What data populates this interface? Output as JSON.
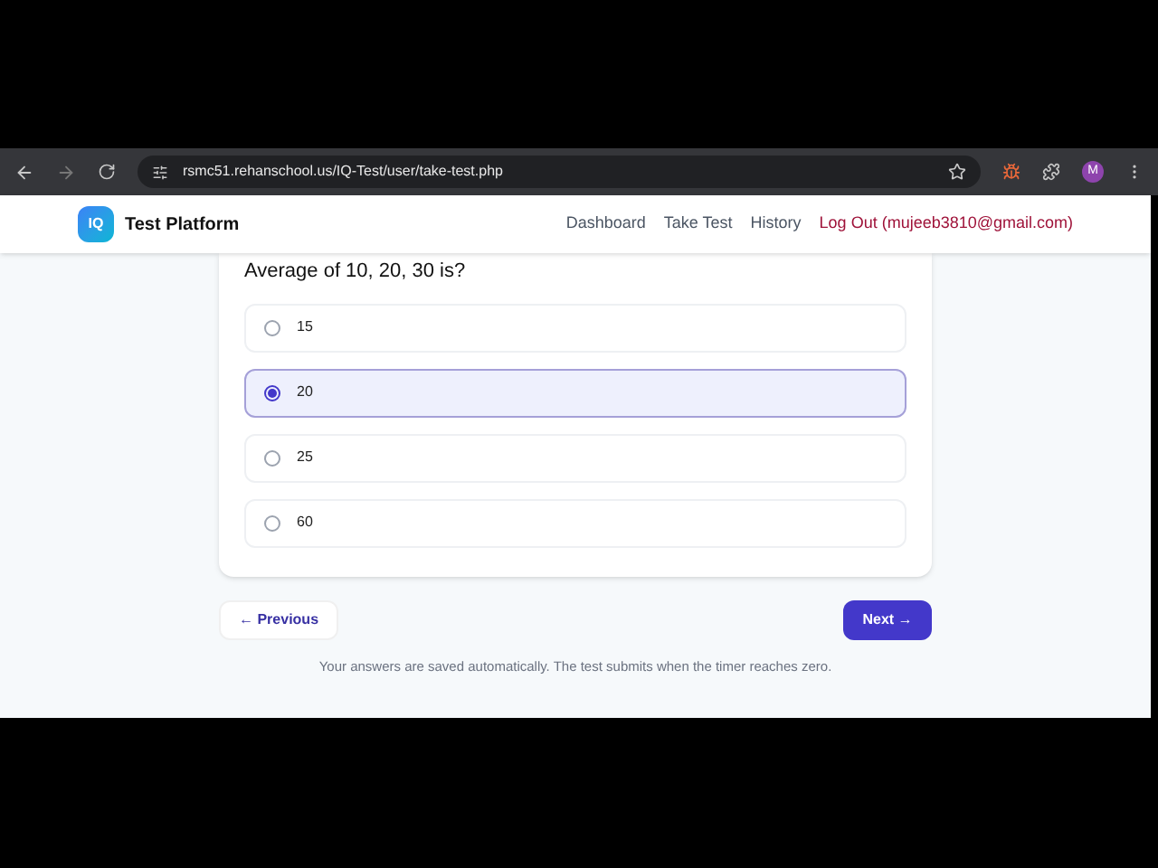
{
  "browser": {
    "url": "rsmc51.rehanschool.us/IQ-Test/user/take-test.php",
    "profile": "M"
  },
  "header": {
    "logo": "IQ",
    "brand": "Test Platform",
    "nav": [
      {
        "label": "Dashboard",
        "kind": "link"
      },
      {
        "label": "Take Test",
        "kind": "link"
      },
      {
        "label": "History",
        "kind": "link"
      },
      {
        "label": "Log Out (mujeeb3810@gmail.com)",
        "kind": "logout"
      }
    ]
  },
  "question": {
    "text": "Average of 10, 20, 30 is?",
    "options": [
      {
        "label": "15",
        "selected": false
      },
      {
        "label": "20",
        "selected": true
      },
      {
        "label": "25",
        "selected": false
      },
      {
        "label": "60",
        "selected": false
      }
    ]
  },
  "buttons": {
    "previous": "← Previous",
    "next": "Next →"
  },
  "note": "Your answers are saved automatically. The test submits when the timer reaches zero."
}
